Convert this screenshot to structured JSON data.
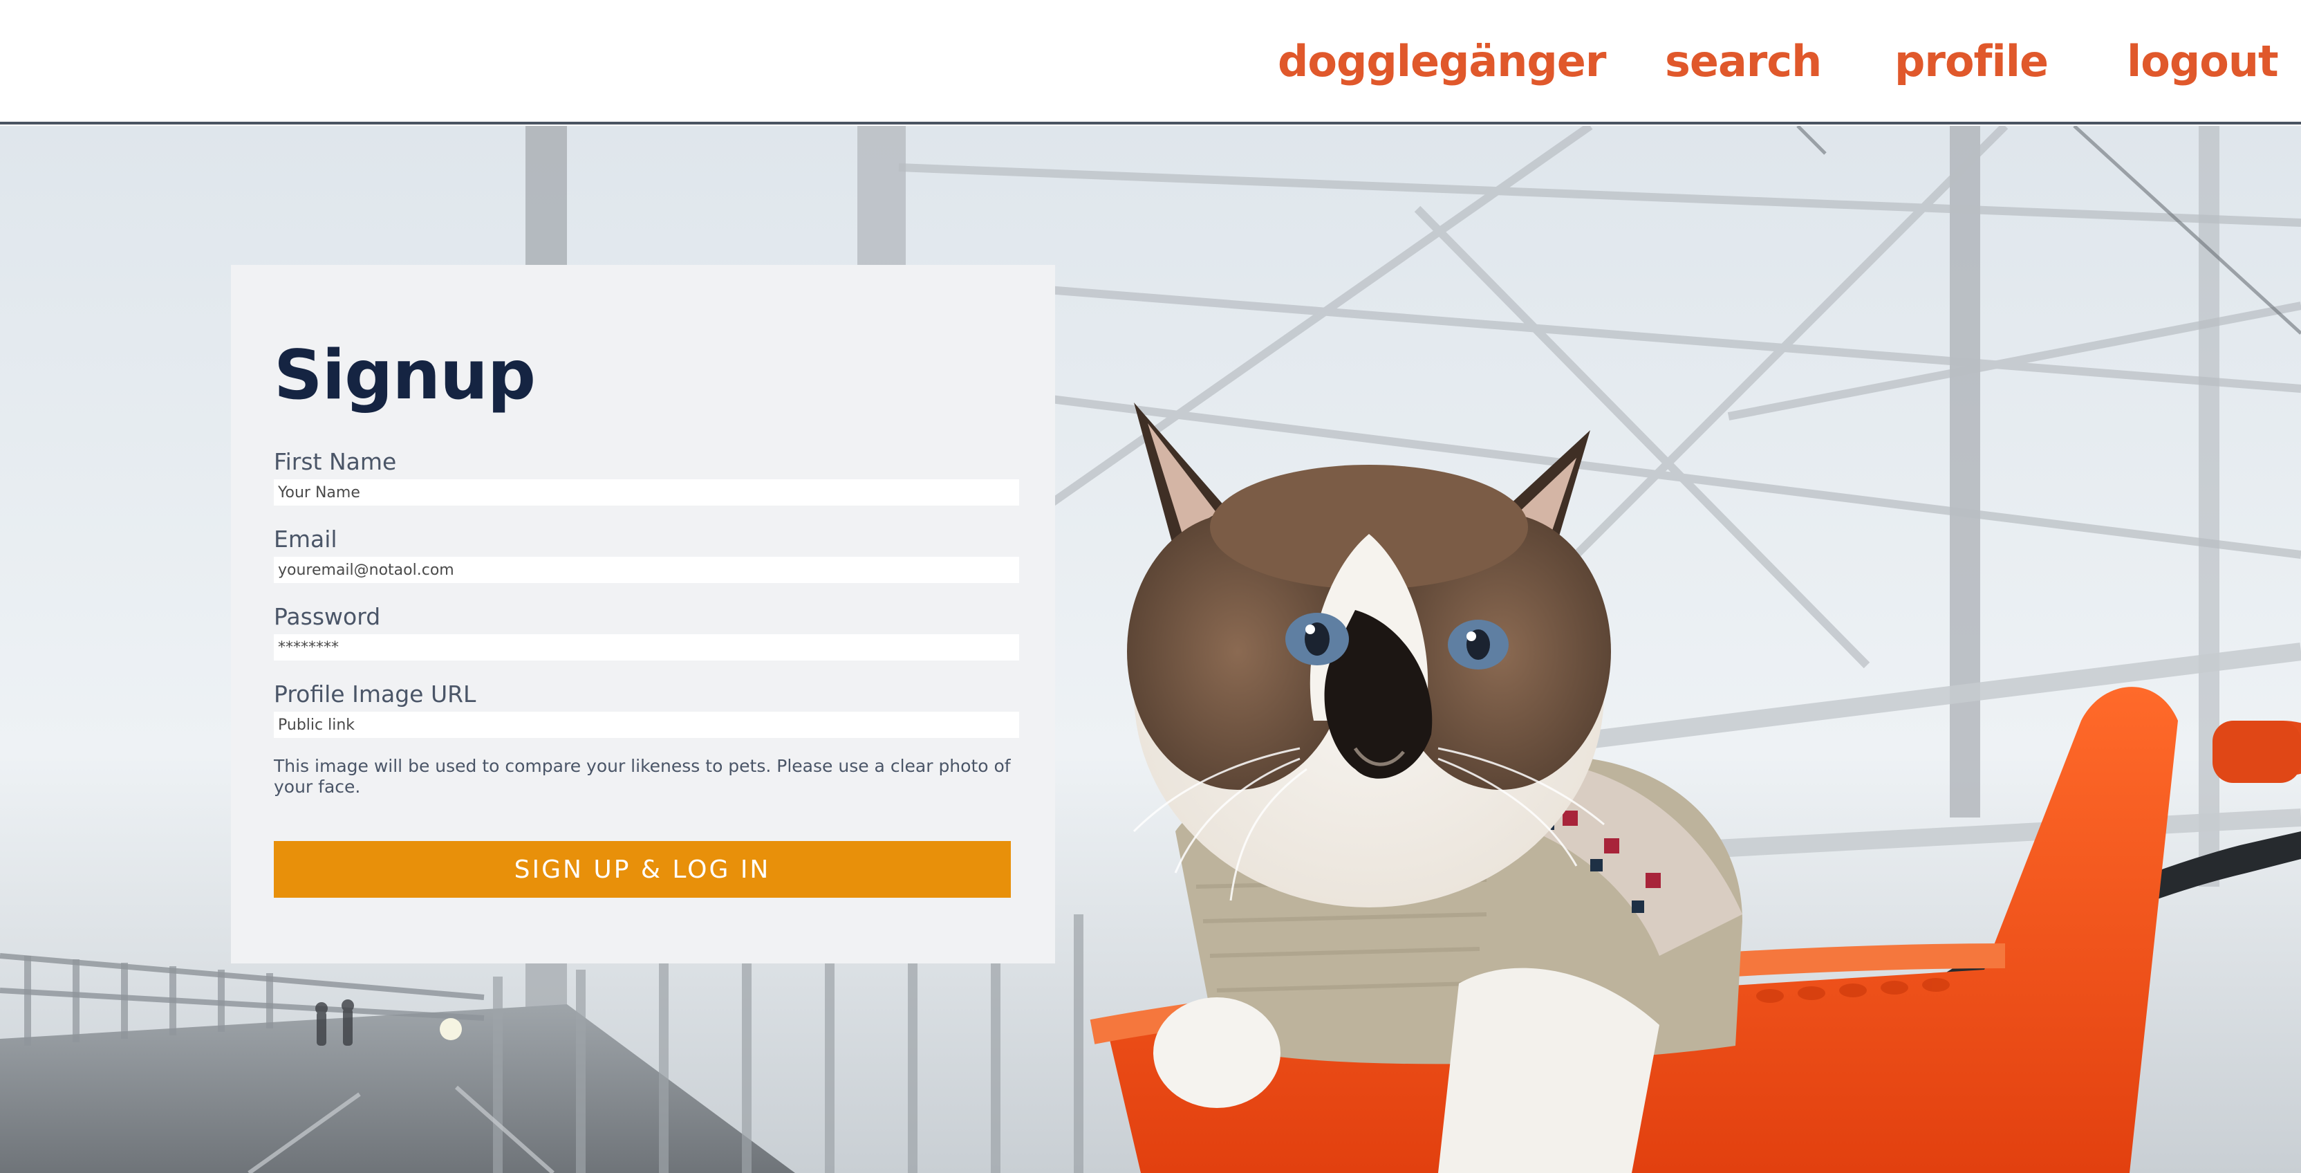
{
  "nav": {
    "brand": "dogglegänger",
    "search": "search",
    "profile": "profile",
    "logout": "logout"
  },
  "signup": {
    "title": "Signup",
    "fields": {
      "first_name": {
        "label": "First Name",
        "placeholder": "Your Name"
      },
      "email": {
        "label": "Email",
        "placeholder": "youremail@notaol.com"
      },
      "password": {
        "label": "Password",
        "placeholder": "********"
      },
      "profile_image": {
        "label": "Profile Image URL",
        "placeholder": "Public link"
      }
    },
    "help_text": "This image will be used to compare your likeness to pets. Please use a clear photo of your face.",
    "submit_label": "SIGN UP & LOG IN"
  },
  "colors": {
    "nav_link": "#e0582b",
    "title": "#152442",
    "button": "#e8900a",
    "card_bg": "#f1f2f4"
  }
}
